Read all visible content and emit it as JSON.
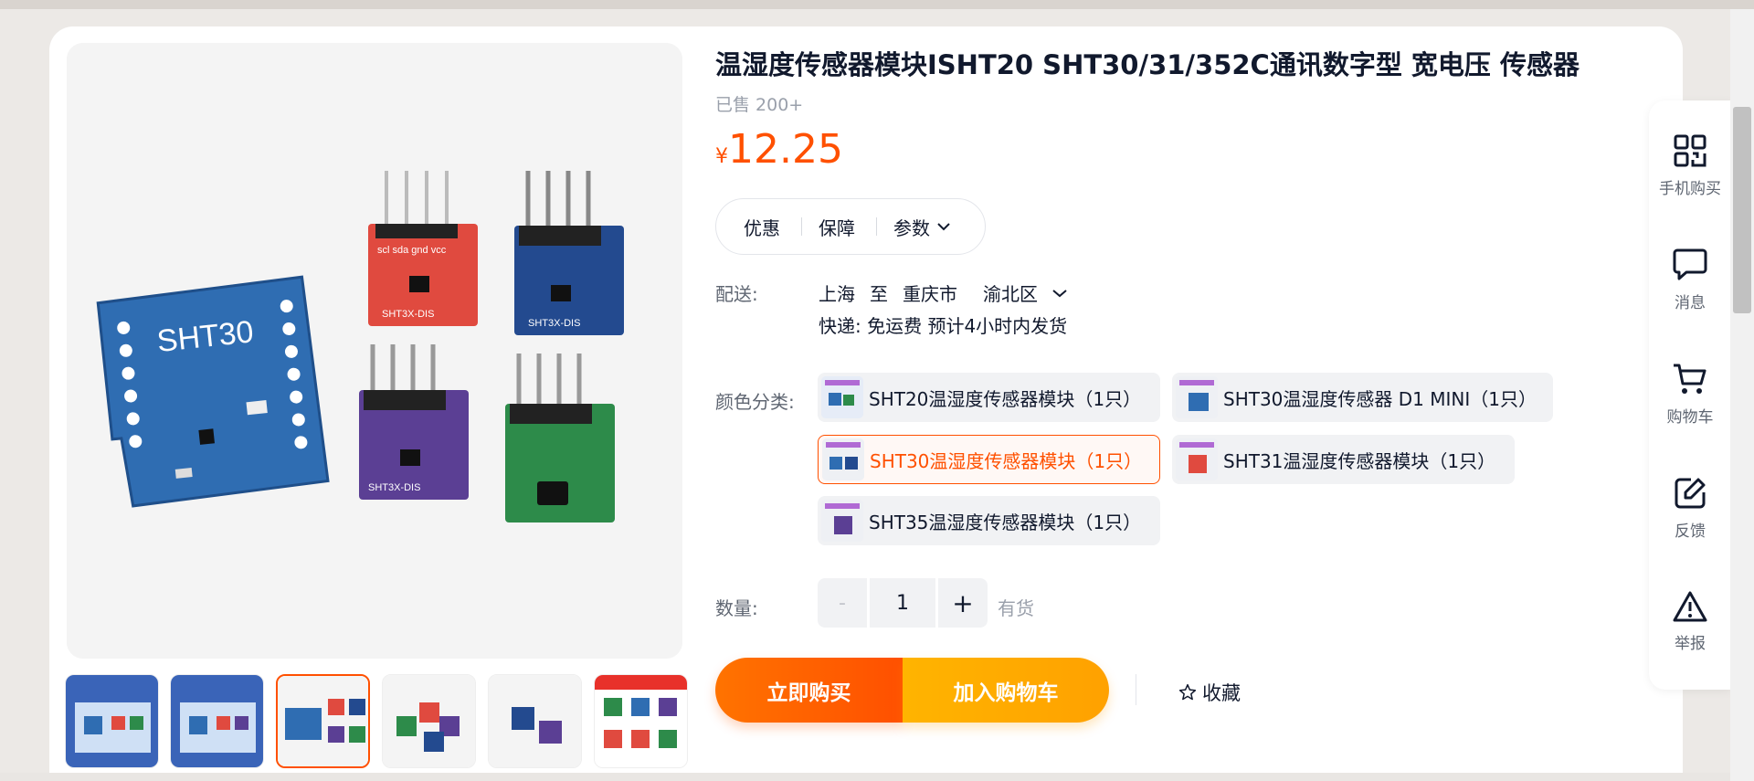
{
  "product": {
    "title": "温湿度传感器模块ISHT20 SHT30/31/352C通讯数字型 宽电压 传感器",
    "sold": "已售 200+",
    "price_symbol": "¥",
    "price": "12.25"
  },
  "pill": {
    "tab1": "优惠",
    "tab2": "保障",
    "tab3": "参数"
  },
  "shipping": {
    "label": "配送:",
    "from": "上海",
    "to_word": "至",
    "city": "重庆市",
    "district": "渝北区",
    "express": "快递: 免运费  预计4小时内发货"
  },
  "color": {
    "label": "颜色分类:",
    "options": [
      "SHT20温湿度传感器模块（1只）",
      "SHT30温湿度传感器 D1 MINI（1只）",
      "SHT30温湿度传感器模块（1只）",
      "SHT31温湿度传感器模块（1只）",
      "SHT35温湿度传感器模块（1只）"
    ],
    "selected_index": 2
  },
  "quantity": {
    "label": "数量:",
    "minus": "-",
    "value": "1",
    "plus": "+",
    "stock": "有货"
  },
  "actions": {
    "buy": "立即购买",
    "cart": "加入购物车",
    "favorite": "收藏"
  },
  "sidebar": {
    "items": [
      {
        "label": "手机购买",
        "icon": "qr-code-icon"
      },
      {
        "label": "消息",
        "icon": "chat-bubble-icon"
      },
      {
        "label": "购物车",
        "icon": "shopping-cart-icon"
      },
      {
        "label": "反馈",
        "icon": "edit-feedback-icon"
      },
      {
        "label": "举报",
        "icon": "warning-icon"
      }
    ]
  },
  "main_image": {
    "board_label": "SHT30",
    "module_label": "SHT3X-DIS",
    "pins": "scl sda gnd vcc"
  },
  "colors": {
    "accent": "#ff5000",
    "buy_gradient": "#ff7300",
    "cart_gradient": "#ffa100",
    "text": "#11192d",
    "muted": "#9aa0ab"
  }
}
